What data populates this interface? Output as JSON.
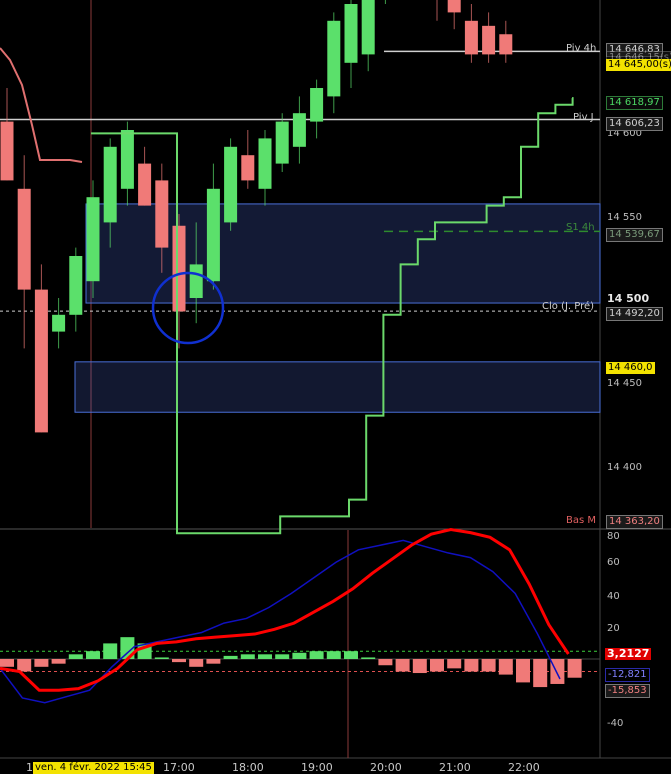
{
  "price_chart": {
    "y_axis_ticks": [
      "14 600",
      "14 550",
      "14 450",
      "14 400"
    ],
    "bold_tick": "14 500",
    "levels": {
      "piv_4h": {
        "label": "Piv 4h",
        "value": "14 646,83"
      },
      "overlap_value": "14 646,15(s)",
      "last_price": "14 645,00(s)",
      "trail_value": "14 618,97",
      "piv_j": {
        "label": "Piv J",
        "value": "14 606,23"
      },
      "s1_4h": {
        "label": "S1 4h",
        "value": "14 539,67"
      },
      "clo_prev": {
        "label": "Clo (J. Pré)",
        "value": "14 492,20"
      },
      "zone_value": "14 460,0",
      "bas": {
        "label": "Bas M",
        "value": "14 363,20"
      }
    },
    "colors": {
      "bull": "#5be06b",
      "bear": "#f07a78",
      "zone": "#4a6fd8",
      "trail": "#6bd96b",
      "upper": "#e07070"
    }
  },
  "oscillator": {
    "y_axis_ticks": [
      "80",
      "60",
      "40",
      "20",
      "-40"
    ],
    "values": {
      "red_line": "3,2127",
      "blue_line": "-12,821",
      "histogram": "-15,853"
    },
    "colors": {
      "red": "#ff0000",
      "blue": "#1010c0"
    }
  },
  "time_axis": {
    "cursor_label": "ven. 4 févr. 2022 15:45",
    "left_digit": "1",
    "labels": [
      "17:00",
      "18:00",
      "19:00",
      "20:00",
      "21:00",
      "22:00"
    ]
  },
  "chart_data": {
    "type": "candlestick",
    "timeframe_minutes": 15,
    "candles": [
      {
        "o": 14605,
        "h": 14625,
        "l": 14570,
        "c": 14570
      },
      {
        "o": 14565,
        "h": 14585,
        "l": 14470,
        "c": 14505
      },
      {
        "o": 14505,
        "h": 14520,
        "l": 14420,
        "c": 14420
      },
      {
        "o": 14480,
        "h": 14500,
        "l": 14470,
        "c": 14490
      },
      {
        "o": 14490,
        "h": 14530,
        "l": 14480,
        "c": 14525
      },
      {
        "o": 14510,
        "h": 14570,
        "l": 14500,
        "c": 14560
      },
      {
        "o": 14545,
        "h": 14595,
        "l": 14530,
        "c": 14590
      },
      {
        "o": 14565,
        "h": 14605,
        "l": 14555,
        "c": 14600
      },
      {
        "o": 14580,
        "h": 14590,
        "l": 14555,
        "c": 14555
      },
      {
        "o": 14570,
        "h": 14580,
        "l": 14515,
        "c": 14530
      },
      {
        "o": 14543,
        "h": 14550,
        "l": 14470,
        "c": 14492
      },
      {
        "o": 14500,
        "h": 14545,
        "l": 14485,
        "c": 14520
      },
      {
        "o": 14510,
        "h": 14580,
        "l": 14505,
        "c": 14565
      },
      {
        "o": 14545,
        "h": 14595,
        "l": 14540,
        "c": 14590
      },
      {
        "o": 14585,
        "h": 14600,
        "l": 14565,
        "c": 14570
      },
      {
        "o": 14565,
        "h": 14600,
        "l": 14555,
        "c": 14595
      },
      {
        "o": 14580,
        "h": 14610,
        "l": 14575,
        "c": 14605
      },
      {
        "o": 14590,
        "h": 14620,
        "l": 14580,
        "c": 14610
      },
      {
        "o": 14605,
        "h": 14630,
        "l": 14595,
        "c": 14625
      },
      {
        "o": 14620,
        "h": 14670,
        "l": 14610,
        "c": 14665
      },
      {
        "o": 14640,
        "h": 14680,
        "l": 14625,
        "c": 14675
      },
      {
        "o": 14645,
        "h": 14690,
        "l": 14635,
        "c": 14685
      },
      {
        "o": 14680,
        "h": 14710,
        "l": 14675,
        "c": 14690
      },
      {
        "o": 14690,
        "h": 14720,
        "l": 14685,
        "c": 14715
      },
      {
        "o": 14705,
        "h": 14725,
        "l": 14695,
        "c": 14715
      },
      {
        "o": 14690,
        "h": 14705,
        "l": 14665,
        "c": 14680
      },
      {
        "o": 14680,
        "h": 14690,
        "l": 14660,
        "c": 14670
      },
      {
        "o": 14665,
        "h": 14675,
        "l": 14640,
        "c": 14645
      },
      {
        "o": 14662,
        "h": 14670,
        "l": 14640,
        "c": 14645
      },
      {
        "o": 14657,
        "h": 14665,
        "l": 14640,
        "c": 14645
      }
    ],
    "trail_stop": [
      14598,
      14598,
      14598,
      14598,
      14598,
      14360,
      14360,
      14360,
      14360,
      14360,
      14360,
      14370,
      14370,
      14370,
      14370,
      14380,
      14430,
      14490,
      14520,
      14535,
      14545,
      14545,
      14545,
      14555,
      14560,
      14590,
      14610,
      14615,
      14618.97
    ],
    "oscillator": {
      "histogram": [
        -5,
        -8,
        -5,
        -3,
        3,
        5,
        10,
        14,
        10,
        1,
        -2,
        -5,
        -3,
        2,
        3,
        3,
        3,
        4,
        5,
        5,
        5,
        1,
        -4,
        -8,
        -9,
        -8,
        -6,
        -8,
        -8,
        -10,
        -15,
        -18,
        -16,
        -12
      ],
      "red_line": [
        -6,
        -8,
        -20,
        -20,
        -19,
        -14,
        -6,
        6,
        10,
        11,
        13,
        14,
        15,
        16,
        19,
        23,
        30,
        37,
        45,
        55,
        64,
        73,
        80,
        83,
        81,
        78,
        70,
        48,
        22,
        3.2127
      ],
      "blue_line": [
        -6,
        -25,
        -28,
        -24,
        -20,
        -5,
        8,
        11,
        14,
        17,
        23,
        26,
        33,
        42,
        52,
        62,
        70,
        73,
        76,
        72,
        68,
        65,
        56,
        42,
        16,
        -12.821
      ]
    }
  }
}
